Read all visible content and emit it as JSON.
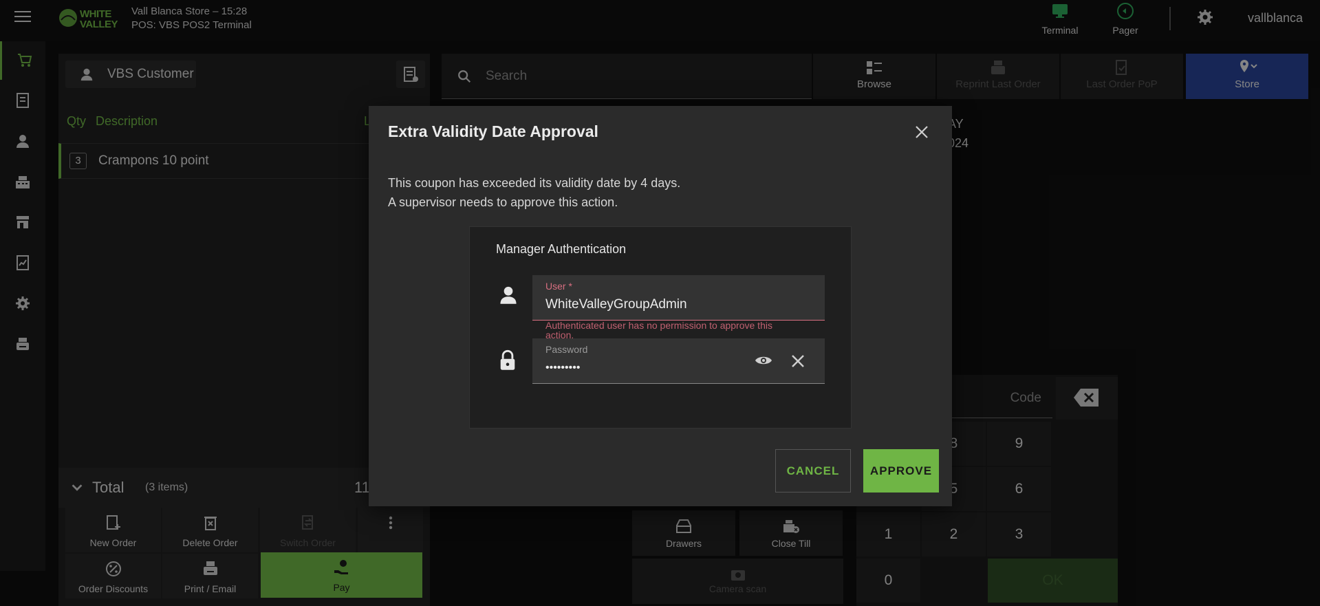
{
  "header": {
    "store_line": "Vall Blanca Store – 15:28",
    "pos_line": "POS: VBS POS2 Terminal",
    "logo_line1": "WHITE",
    "logo_line2": "VALLEY",
    "terminal_label": "Terminal",
    "pager_label": "Pager",
    "username": "vallblanca"
  },
  "colors": {
    "accent": "#6fb545",
    "store_button": "#284394",
    "error": "#d86f81",
    "background": "#0f0f0f"
  },
  "sidebar": {
    "items": [
      {
        "name": "cart-icon",
        "active": true
      },
      {
        "name": "receipt-icon",
        "active": false
      },
      {
        "name": "person-icon",
        "active": false
      },
      {
        "name": "cash-register-icon",
        "active": false
      },
      {
        "name": "store-icon",
        "active": false
      },
      {
        "name": "report-icon",
        "active": false
      },
      {
        "name": "gear-icon",
        "active": false
      },
      {
        "name": "printer-icon",
        "active": false
      }
    ]
  },
  "order": {
    "customer": "VBS Customer",
    "col_qty": "Qty",
    "col_description": "Description",
    "col_line": "L",
    "lines": [
      {
        "qty": "3",
        "description": "Crampons 10 point"
      }
    ],
    "total_label": "Total",
    "total_items": "(3 items)",
    "total_amount": "11"
  },
  "actions": {
    "new_order": "New Order",
    "delete_order": "Delete Order",
    "switch_order": "Switch Order",
    "order_discounts": "Order Discounts",
    "print_email": "Print / Email",
    "pay": "Pay"
  },
  "toolbar": {
    "search_placeholder": "Search",
    "browse": "Browse",
    "reprint": "Reprint Last Order",
    "last_order_pop": "Last Order PoP",
    "store": "Store"
  },
  "info": {
    "line1": "AY",
    "line2": "024"
  },
  "keypad": {
    "code_placeholder": "Code",
    "keys": [
      "8",
      "9",
      "5",
      "6",
      "1",
      "2",
      "3",
      "0"
    ],
    "ok": "OK"
  },
  "till": {
    "drawers": "Drawers",
    "close_till": "Close Till",
    "camera_scan": "Camera scan"
  },
  "modal": {
    "title": "Extra Validity Date Approval",
    "message_line1": "This coupon has exceeded its validity date by 4 days.",
    "message_line2": "A supervisor needs to approve this action.",
    "auth_title": "Manager Authentication",
    "user_label": "User *",
    "user_value": "WhiteValleyGroupAdmin",
    "user_error_line1": "Authenticated user has no permission to approve this",
    "user_error_line2": "action.",
    "password_label": "Password",
    "password_value": "•••••••••",
    "cancel": "CANCEL",
    "approve": "APPROVE"
  }
}
